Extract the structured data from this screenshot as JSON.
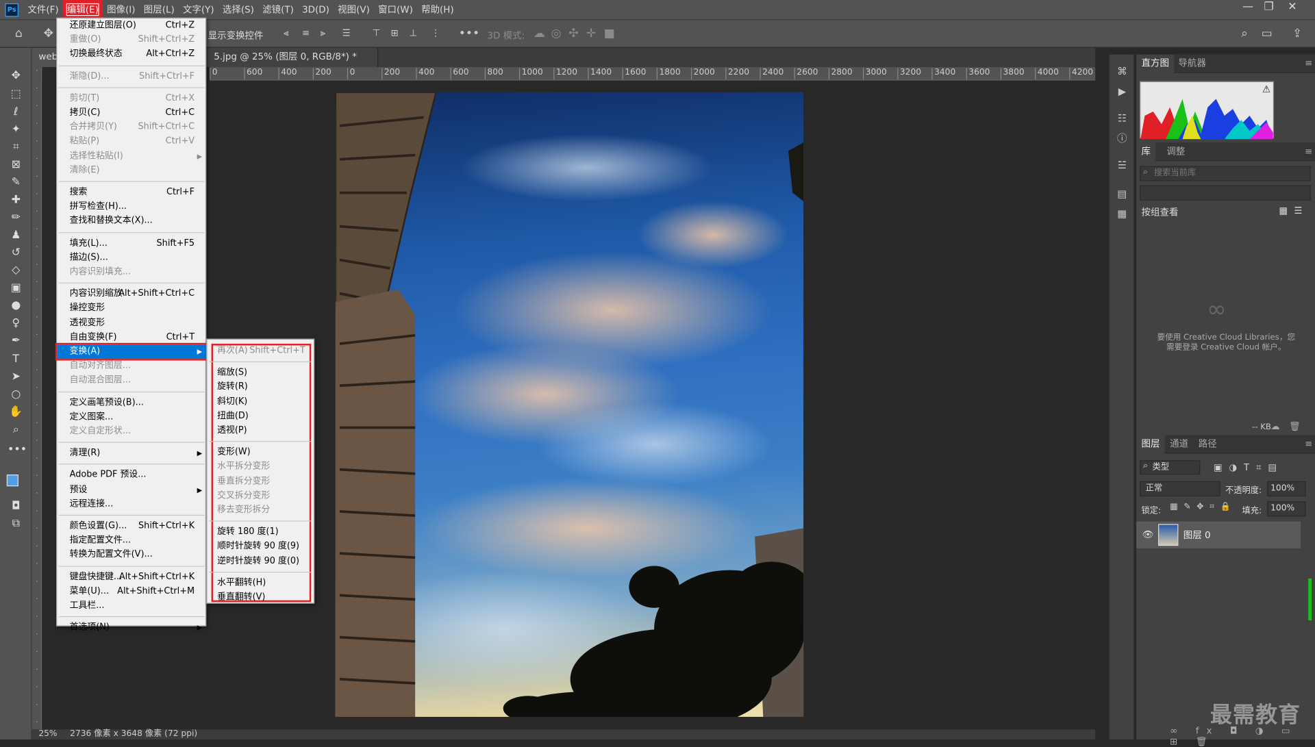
{
  "menubar": {
    "logo": "Ps",
    "items": [
      "文件(F)",
      "编辑(E)",
      "图像(I)",
      "图层(L)",
      "文字(Y)",
      "选择(S)",
      "滤镜(T)",
      "3D(D)",
      "视图(V)",
      "窗口(W)",
      "帮助(H)"
    ],
    "window_controls": [
      "—",
      "❐",
      "✕"
    ]
  },
  "options": {
    "transform_label": "显示变换控件",
    "mode_3d_label": "3D 模式:"
  },
  "doc": {
    "tab_left": "webu",
    "tab_title": "5.jpg @ 25% (图层 0, RGB/8*) *",
    "tab_close": "×"
  },
  "ruler": {
    "top": [
      "0",
      "600",
      "400",
      "200",
      "0",
      "200",
      "400",
      "600",
      "800",
      "1000",
      "1200",
      "1400",
      "1600",
      "1800",
      "2000",
      "2200",
      "2400",
      "2600",
      "2800",
      "3000",
      "3200",
      "3400",
      "3600",
      "3800",
      "4000",
      "4200",
      "4"
    ]
  },
  "edit_menu": {
    "items": [
      {
        "label": "还原建立图层(O)",
        "shortcut": "Ctrl+Z",
        "disabled": false
      },
      {
        "label": "重做(O)",
        "shortcut": "Shift+Ctrl+Z",
        "disabled": true
      },
      {
        "label": "切换最终状态",
        "shortcut": "Alt+Ctrl+Z",
        "disabled": false
      },
      {
        "sep": true
      },
      {
        "label": "渐隐(D)...",
        "shortcut": "Shift+Ctrl+F",
        "disabled": true
      },
      {
        "sep": true
      },
      {
        "label": "剪切(T)",
        "shortcut": "Ctrl+X",
        "disabled": true
      },
      {
        "label": "拷贝(C)",
        "shortcut": "Ctrl+C",
        "disabled": false
      },
      {
        "label": "合并拷贝(Y)",
        "shortcut": "Shift+Ctrl+C",
        "disabled": true
      },
      {
        "label": "粘贴(P)",
        "shortcut": "Ctrl+V",
        "disabled": true
      },
      {
        "label": "选择性粘贴(I)",
        "shortcut": "",
        "disabled": true,
        "submenu": true
      },
      {
        "label": "清除(E)",
        "shortcut": "",
        "disabled": true
      },
      {
        "sep": true
      },
      {
        "label": "搜索",
        "shortcut": "Ctrl+F",
        "disabled": false
      },
      {
        "label": "拼写检查(H)...",
        "shortcut": "",
        "disabled": false
      },
      {
        "label": "查找和替换文本(X)...",
        "shortcut": "",
        "disabled": false
      },
      {
        "sep": true
      },
      {
        "label": "填充(L)...",
        "shortcut": "Shift+F5",
        "disabled": false
      },
      {
        "label": "描边(S)...",
        "shortcut": "",
        "disabled": false
      },
      {
        "label": "内容识别填充...",
        "shortcut": "",
        "disabled": true
      },
      {
        "sep": true
      },
      {
        "label": "内容识别缩放",
        "shortcut": "Alt+Shift+Ctrl+C",
        "disabled": false
      },
      {
        "label": "操控变形",
        "shortcut": "",
        "disabled": false
      },
      {
        "label": "透视变形",
        "shortcut": "",
        "disabled": false
      },
      {
        "label": "自由变换(F)",
        "shortcut": "Ctrl+T",
        "disabled": false
      },
      {
        "label": "变换(A)",
        "shortcut": "",
        "disabled": false,
        "submenu": true,
        "highlight": true
      },
      {
        "label": "自动对齐图层...",
        "shortcut": "",
        "disabled": true
      },
      {
        "label": "自动混合图层...",
        "shortcut": "",
        "disabled": true
      },
      {
        "sep": true
      },
      {
        "label": "定义画笔预设(B)...",
        "shortcut": "",
        "disabled": false
      },
      {
        "label": "定义图案...",
        "shortcut": "",
        "disabled": false
      },
      {
        "label": "定义自定形状...",
        "shortcut": "",
        "disabled": true
      },
      {
        "sep": true
      },
      {
        "label": "清理(R)",
        "shortcut": "",
        "disabled": false,
        "submenu": true
      },
      {
        "sep": true
      },
      {
        "label": "Adobe PDF 预设...",
        "shortcut": "",
        "disabled": false
      },
      {
        "label": "预设",
        "shortcut": "",
        "disabled": false,
        "submenu": true
      },
      {
        "label": "远程连接...",
        "shortcut": "",
        "disabled": false
      },
      {
        "sep": true
      },
      {
        "label": "颜色设置(G)...",
        "shortcut": "Shift+Ctrl+K",
        "disabled": false
      },
      {
        "label": "指定配置文件...",
        "shortcut": "",
        "disabled": false
      },
      {
        "label": "转换为配置文件(V)...",
        "shortcut": "",
        "disabled": false
      },
      {
        "sep": true
      },
      {
        "label": "键盘快捷键...",
        "shortcut": "Alt+Shift+Ctrl+K",
        "disabled": false
      },
      {
        "label": "菜单(U)...",
        "shortcut": "Alt+Shift+Ctrl+M",
        "disabled": false
      },
      {
        "label": "工具栏...",
        "shortcut": "",
        "disabled": false
      },
      {
        "sep": true
      },
      {
        "label": "首选项(N)",
        "shortcut": "",
        "disabled": false,
        "submenu": true
      }
    ]
  },
  "transform_menu": {
    "items": [
      {
        "label": "再次(A)",
        "shortcut": "Shift+Ctrl+T",
        "disabled": true
      },
      {
        "sep": true
      },
      {
        "label": "缩放(S)",
        "shortcut": "",
        "disabled": false
      },
      {
        "label": "旋转(R)",
        "shortcut": "",
        "disabled": false
      },
      {
        "label": "斜切(K)",
        "shortcut": "",
        "disabled": false
      },
      {
        "label": "扭曲(D)",
        "shortcut": "",
        "disabled": false
      },
      {
        "label": "透视(P)",
        "shortcut": "",
        "disabled": false
      },
      {
        "sep": true
      },
      {
        "label": "变形(W)",
        "shortcut": "",
        "disabled": false
      },
      {
        "label": "水平拆分变形",
        "shortcut": "",
        "disabled": true
      },
      {
        "label": "垂直拆分变形",
        "shortcut": "",
        "disabled": true
      },
      {
        "label": "交叉拆分变形",
        "shortcut": "",
        "disabled": true
      },
      {
        "label": "移去变形拆分",
        "shortcut": "",
        "disabled": true
      },
      {
        "sep": true
      },
      {
        "label": "旋转 180 度(1)",
        "shortcut": "",
        "disabled": false
      },
      {
        "label": "顺时针旋转 90 度(9)",
        "shortcut": "",
        "disabled": false
      },
      {
        "label": "逆时针旋转 90 度(0)",
        "shortcut": "",
        "disabled": false
      },
      {
        "sep": true
      },
      {
        "label": "水平翻转(H)",
        "shortcut": "",
        "disabled": false
      },
      {
        "label": "垂直翻转(V)",
        "shortcut": "",
        "disabled": false
      }
    ]
  },
  "histogram": {
    "tab1": "直方图",
    "tab2": "导航器",
    "warning": "⚠"
  },
  "library": {
    "tab1": "库",
    "tab2": "调整",
    "search_placeholder": "搜索当前库",
    "group_label": "按组查看",
    "message_line1": "要使用 Creative Cloud Libraries，您",
    "message_line2": "需要登录 Creative Cloud 帐户。",
    "size": "-- KB"
  },
  "layers": {
    "tab1": "图层",
    "tab2": "通道",
    "tab3": "路径",
    "filter_label": "类型",
    "blend_mode": "正常",
    "opacity_label": "不透明度:",
    "opacity_value": "100%",
    "lock_label": "锁定:",
    "fill_label": "填充:",
    "fill_value": "100%",
    "layer_name": "图层 0"
  },
  "status": {
    "zoom": "25%",
    "info": "2736 像素 x 3648 像素 (72 ppi)"
  },
  "watermark": "最需教育",
  "colors": {
    "accent_red": "#e01f26",
    "highlight_blue": "#0078d7"
  }
}
